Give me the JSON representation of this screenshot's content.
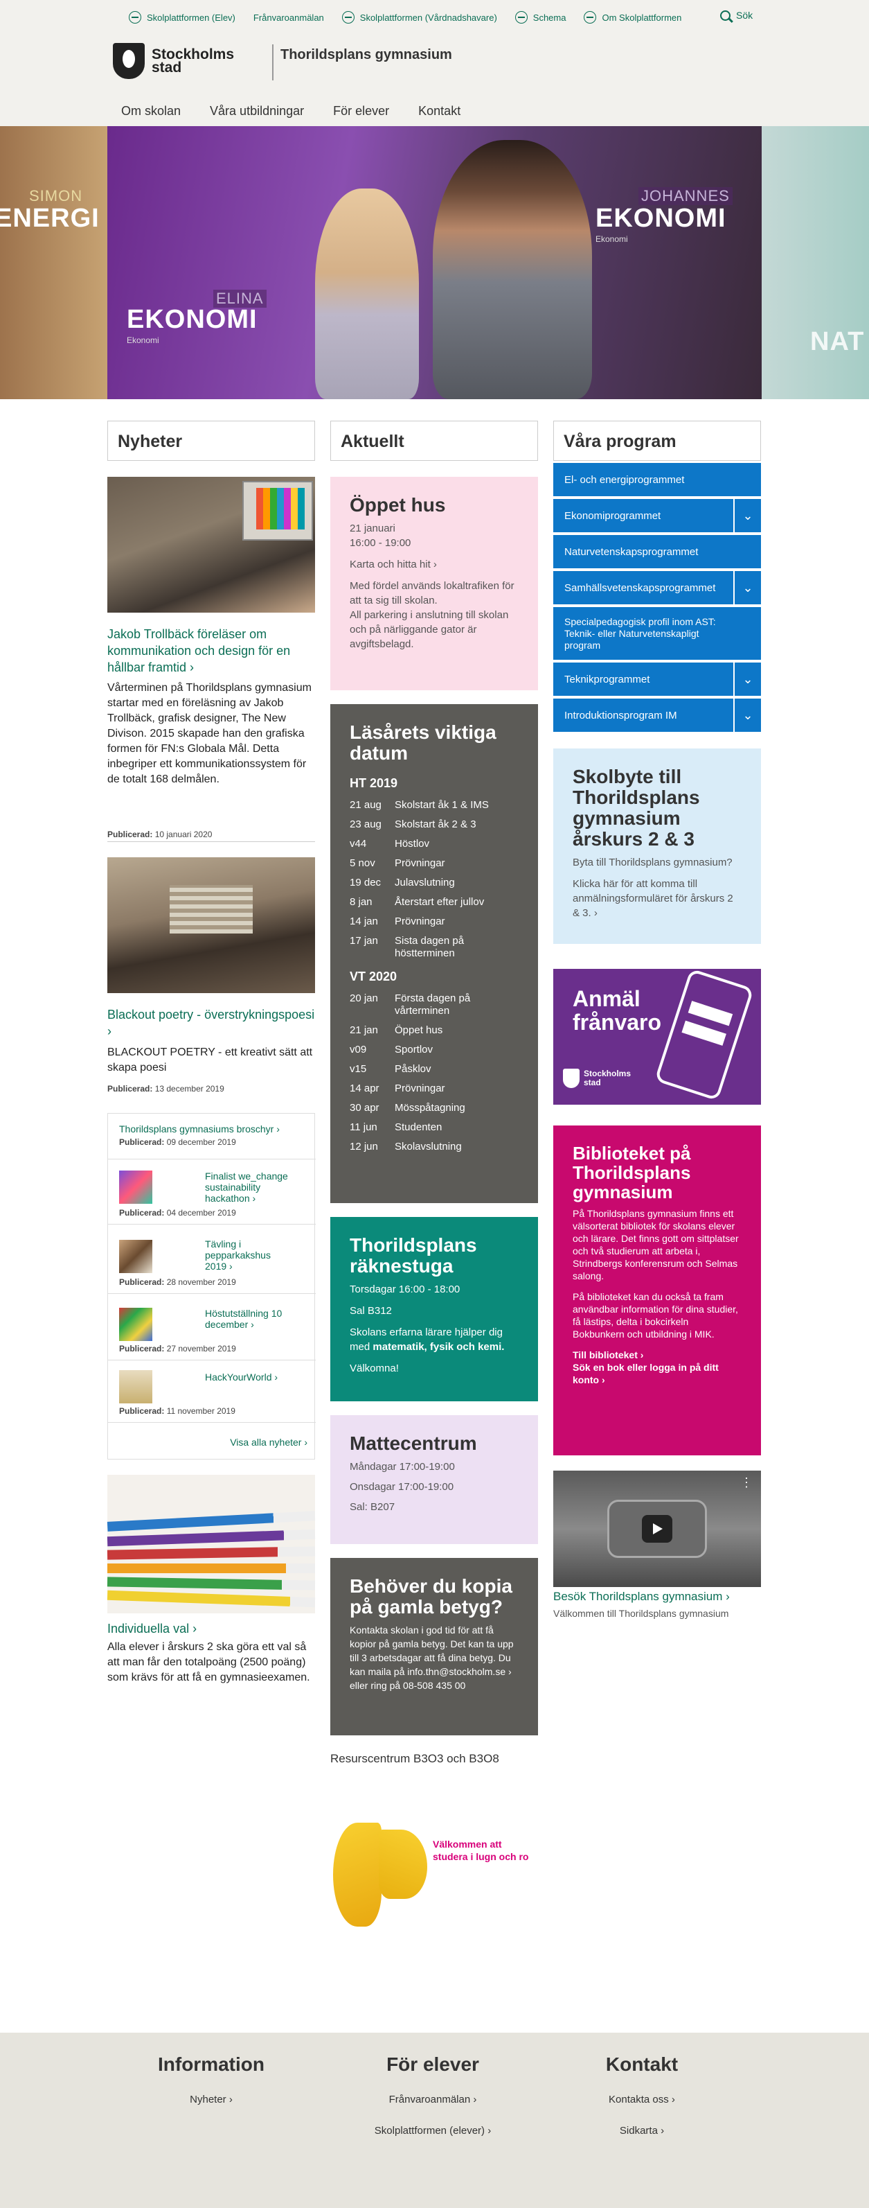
{
  "toplinks": [
    "Skolplattformen (Elev)",
    "Frånvaroanmälan",
    "Skolplattformen (Vårdnadshavare)",
    "Schema",
    "Om Skolplattformen"
  ],
  "search_label": "Sök",
  "logo_text_1": "Stockholms",
  "logo_text_2": "stad",
  "school_name": "Thorildsplans gymnasium",
  "nav": [
    "Om skolan",
    "Våra utbildningar",
    "För elever",
    "Kontakt"
  ],
  "hero": {
    "left_tag": "SIMON",
    "left_name": "ENERGI",
    "right_tag": "JOHANNES",
    "right_name": "EKONOMI",
    "right_sub": "Ekonomi",
    "bottom_tag": "ELINA",
    "bottom_name": "EKONOMI",
    "bottom_sub": "Ekonomi",
    "far_right": "NAT"
  },
  "columns": {
    "news": "Nyheter",
    "current": "Aktuellt",
    "programs": "Våra program"
  },
  "news": [
    {
      "title": "Jakob Trollbäck föreläser om kommunikation och design för en hållbar framtid ›",
      "body": "Vårterminen på Thorildsplans gymnasium startar med en föreläsning av Jakob Trollbäck, grafisk designer, The New Divison. 2015 skapade han den grafiska formen för FN:s Globala Mål. Detta inbegriper ett kommunikationssystem för de totalt 168 delmålen.",
      "pub_label": "Publicerad:",
      "pub_date": "10 januari 2020"
    },
    {
      "title": "Blackout poetry - överstrykningspoesi  ›",
      "body": "BLACKOUT POETRY - ett kreativt sätt att skapa poesi",
      "pub_label": "Publicerad:",
      "pub_date": "13 december 2019"
    }
  ],
  "news_list": [
    {
      "title": "Thorildsplans gymnasiums broschyr ›",
      "pub_date": "09 december 2019"
    },
    {
      "title": "Finalist we_change sustainability hackathon ›",
      "pub_date": "04 december 2019"
    },
    {
      "title": "Tävling i pepparkakshus 2019 ›",
      "pub_date": "28 november 2019"
    },
    {
      "title": "Höstutställning 10 december ›",
      "pub_date": "27 november 2019"
    },
    {
      "title": "HackYourWorld ›",
      "pub_date": "11 november 2019"
    }
  ],
  "pub_label": "Publicerad:",
  "see_all": "Visa alla nyheter ›",
  "individual": {
    "title": "Individuella val ›",
    "body": "Alla elever i årskurs 2 ska göra ett val så att man får den totalpoäng (2500 poäng) som krävs för att få en gymnasieexamen."
  },
  "open_house": {
    "title": "Öppet hus",
    "date": "21 januari",
    "time": "16:00 - 19:00",
    "link": "Karta och hitta hit ›",
    "note1": "Med fördel används lokaltrafiken för att ta sig till skolan.",
    "note2": "All parkering i anslutning till skolan och på närliggande gator är avgiftsbelagd."
  },
  "important": {
    "title": "Läsårets viktiga datum",
    "h1": "HT 2019",
    "ht": [
      [
        "21 aug",
        "Skolstart åk 1 & IMS"
      ],
      [
        "23 aug",
        "Skolstart åk 2 & 3"
      ],
      [
        "v44",
        "Höstlov"
      ],
      [
        "5 nov",
        "Prövningar"
      ],
      [
        "19 dec",
        "Julavslutning"
      ],
      [
        "8 jan",
        "Återstart efter jullov"
      ],
      [
        "14 jan",
        "Prövningar"
      ],
      [
        "17 jan",
        "Sista dagen på höstterminen"
      ]
    ],
    "h2": "VT 2020",
    "vt": [
      [
        "20 jan",
        "Första dagen på vårterminen"
      ],
      [
        "21 jan",
        "Öppet hus"
      ],
      [
        "v09",
        "Sportlov"
      ],
      [
        "v15",
        "Påsklov"
      ],
      [
        "14 apr",
        "Prövningar"
      ],
      [
        "30 apr",
        "Mösspåtagning"
      ],
      [
        "11 jun",
        "Studenten"
      ],
      [
        "12 jun",
        "Skolavslutning"
      ]
    ]
  },
  "math_workshop": {
    "title": "Thorildsplans räknestuga",
    "time": "Torsdagar 16:00 - 18:00",
    "room": "Sal B312",
    "desc_pre": "Skolans erfarna lärare hjälper dig med ",
    "desc_bold": "matematik, fysik och kemi.",
    "welcome": "Välkomna!"
  },
  "math_center": {
    "title": "Mattecentrum",
    "l1": "Måndagar 17:00-19:00",
    "l2": "Onsdagar 17:00-19:00",
    "l3": "Sal: B207"
  },
  "grades": {
    "title": "Behöver du kopia på gamla betyg?",
    "body": "Kontakta skolan i god tid för att få kopior på gamla betyg. Det kan ta upp till 3 arbetsdagar att få dina betyg. Du kan maila på info.thn@stockholm.se › eller ring på 08-508 435 00"
  },
  "resource": "Resurscentrum B3O3 och B3O8",
  "butterfly_text": "Välkommen att studera i lugn och ro",
  "programs": [
    "El- och energiprogrammet",
    "Ekonomiprogrammet",
    "Naturvetenskapsprogrammet",
    "Samhällsvetenskapsprogrammet",
    "Specialpedagogisk profil inom AST: Teknik- eller Naturvetenskapligt program",
    "Teknikprogrammet",
    "Introduktionsprogram IM"
  ],
  "switch": {
    "title": "Skolbyte till Thorildsplans gymnasium årskurs 2 & 3",
    "q": "Byta till Thorildsplans gymnasium?",
    "body": "Klicka här för att komma till anmälningsformuläret för årskurs 2 & 3. ›"
  },
  "absence": {
    "title": "Anmäl frånvaro",
    "logo": "Stockholms stad"
  },
  "library": {
    "title": "Biblioteket på Thorildsplans gymnasium",
    "p1": "På Thorildsplans gymnasium finns ett välsorterat bibliotek för skolans elever och lärare. Det finns gott om sittplatser och två studierum att arbeta i, Strindbergs konferensrum och Selmas salong.",
    "p2": "På biblioteket kan du också ta fram användbar information för dina studier, få lästips, delta i bokcirkeln Bokbunkern och utbildning i MIK.",
    "l1": "Till biblioteket ›",
    "l2": "Sök en bok eller logga in på ditt konto ›"
  },
  "video": {
    "title": "Besök Thorildsplans gymnasium ›",
    "sub": "Välkommen till Thorildsplans gymnasium"
  },
  "footer": {
    "c1": "Information",
    "c1_links": [
      "Nyheter ›"
    ],
    "c2": "För elever",
    "c2_links": [
      "Frånvaroanmälan ›",
      "Skolplattformen (elever) ›"
    ],
    "c3": "Kontakt",
    "c3_links": [
      "Kontakta oss ›",
      "Sidkarta ›"
    ]
  }
}
